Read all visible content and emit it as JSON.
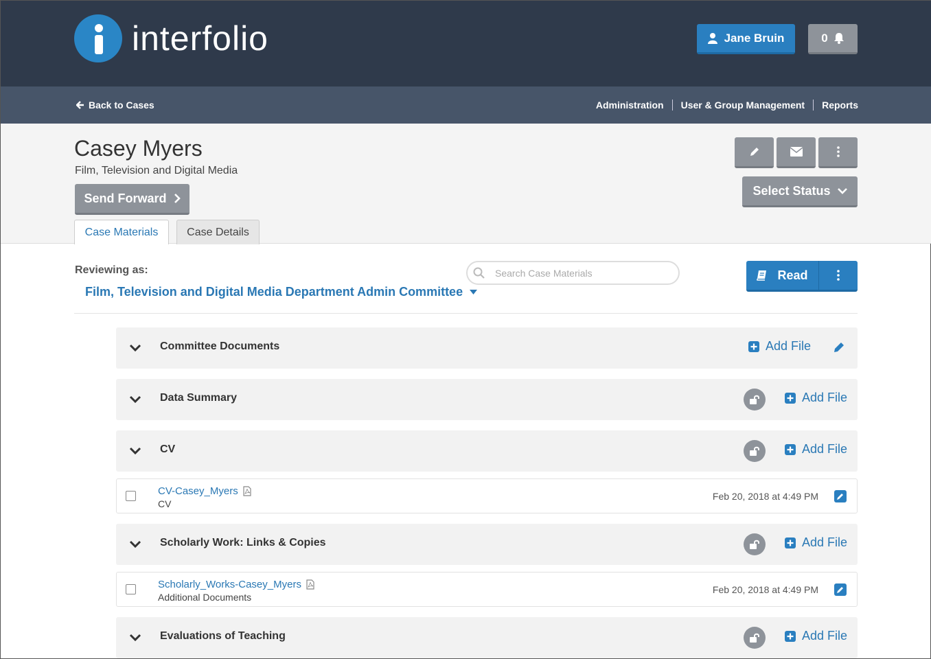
{
  "brand": {
    "name": "interfolio"
  },
  "header": {
    "user_name": "Jane Bruin",
    "notification_count": "0"
  },
  "subnav": {
    "back_label": "Back to Cases",
    "links": [
      "Administration",
      "User & Group Management",
      "Reports"
    ]
  },
  "case": {
    "name": "Casey Myers",
    "department": "Film, Television and Digital Media",
    "send_forward_label": "Send Forward",
    "select_status_label": "Select Status",
    "tabs": [
      {
        "label": "Case Materials",
        "active": true
      },
      {
        "label": "Case Details",
        "active": false
      }
    ]
  },
  "review": {
    "reviewing_label": "Reviewing as:",
    "committee": "Film, Television and Digital Media Department Admin Committee",
    "search_placeholder": "Search Case Materials",
    "read_label": "Read"
  },
  "sections": [
    {
      "title": "Committee Documents",
      "add_label": "Add File"
    },
    {
      "title": "Data Summary",
      "add_label": "Add File"
    },
    {
      "title": "CV",
      "add_label": "Add File"
    },
    {
      "title": "Scholarly Work: Links & Copies",
      "add_label": "Add File"
    },
    {
      "title": "Evaluations of Teaching",
      "add_label": "Add File"
    }
  ],
  "files": [
    {
      "name": "CV-Casey_Myers",
      "type": "CV",
      "date": "Feb 20, 2018 at 4:49 PM"
    },
    {
      "name": "Scholarly_Works-Casey_Myers",
      "type": "Additional Documents",
      "date": "Feb 20, 2018 at 4:49 PM"
    }
  ],
  "colors": {
    "primary": "#2a7fc0",
    "header_bg": "#2f3a4b",
    "subnav_bg": "#475569",
    "neutral_btn": "#8e939a"
  }
}
